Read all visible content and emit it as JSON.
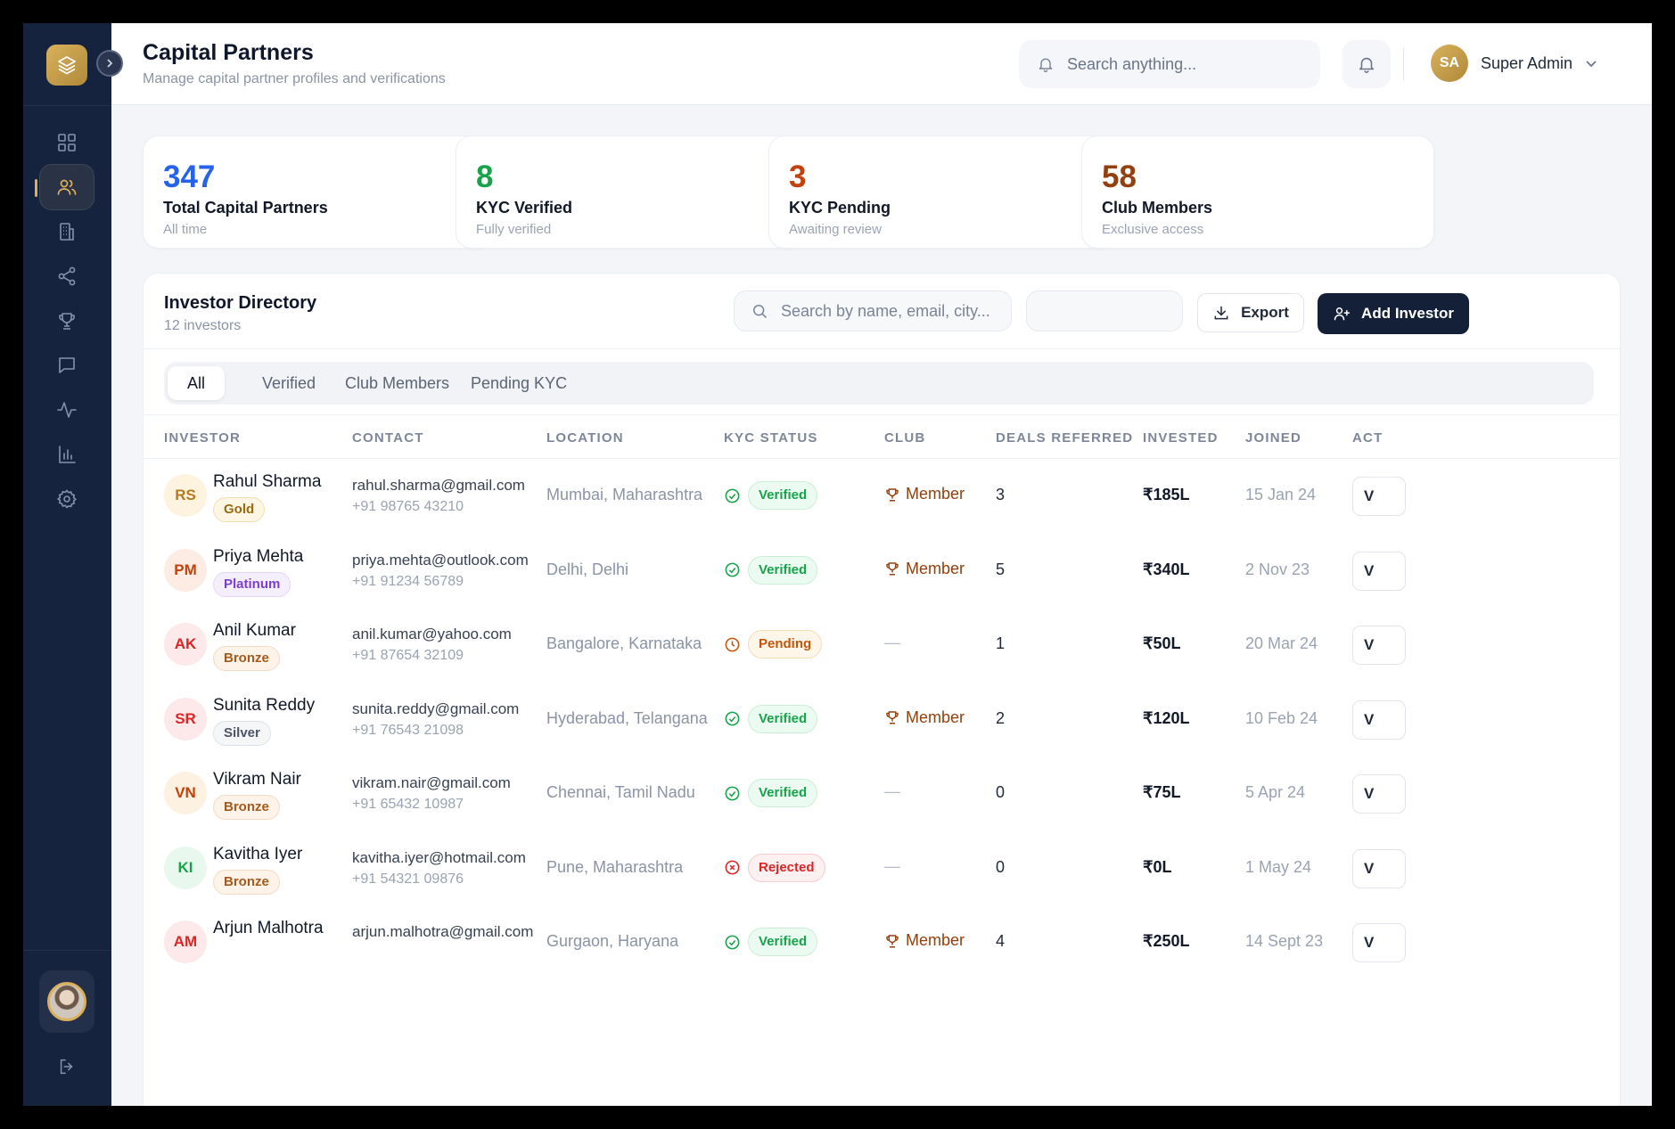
{
  "header": {
    "title": "Capital Partners",
    "subtitle": "Manage capital partner profiles and verifications",
    "search_placeholder": "Search anything...",
    "user_initials": "SA",
    "user_name": "Super Admin"
  },
  "sidebar": {
    "items": [
      {
        "icon": "grid-icon",
        "active": false
      },
      {
        "icon": "users-icon",
        "active": true
      },
      {
        "icon": "building-icon",
        "active": false
      },
      {
        "icon": "share-icon",
        "active": false
      },
      {
        "icon": "trophy-icon",
        "active": false
      },
      {
        "icon": "chat-icon",
        "active": false
      },
      {
        "icon": "activity-icon",
        "active": false
      },
      {
        "icon": "bar-chart-icon",
        "active": false
      },
      {
        "icon": "gear-icon",
        "active": false
      }
    ]
  },
  "stats": [
    {
      "value": "347",
      "label": "Total Capital Partners",
      "sub": "All time",
      "color": "#2563eb"
    },
    {
      "value": "8",
      "label": "KYC Verified",
      "sub": "Fully verified",
      "color": "#16a34a"
    },
    {
      "value": "3",
      "label": "KYC Pending",
      "sub": "Awaiting review",
      "color": "#c2410c"
    },
    {
      "value": "58",
      "label": "Club Members",
      "sub": "Exclusive access",
      "color": "#92400e"
    }
  ],
  "directory": {
    "title": "Investor Directory",
    "count": "12 investors",
    "search_placeholder": "Search by name, email, city...",
    "export_label": "Export",
    "add_label": "Add Investor",
    "tabs": [
      "All",
      "Verified",
      "Club Members",
      "Pending KYC"
    ],
    "active_tab": "All",
    "columns": [
      "INVESTOR",
      "CONTACT",
      "LOCATION",
      "KYC STATUS",
      "CLUB",
      "DEALS REFERRED",
      "INVESTED",
      "JOINED",
      "ACT"
    ],
    "rows": [
      {
        "initials": "RS",
        "name": "Rahul Sharma",
        "tier": "Gold",
        "email": "rahul.sharma@gmail.com",
        "phone": "+91 98765 43210",
        "location": "Mumbai, Maharashtra",
        "kyc": "Verified",
        "club": "Member",
        "deals": "3",
        "invested": "₹185L",
        "joined": "15 Jan 24",
        "action": "V"
      },
      {
        "initials": "PM",
        "name": "Priya Mehta",
        "tier": "Platinum",
        "email": "priya.mehta@outlook.com",
        "phone": "+91 91234 56789",
        "location": "Delhi, Delhi",
        "kyc": "Verified",
        "club": "Member",
        "deals": "5",
        "invested": "₹340L",
        "joined": "2 Nov 23",
        "action": "V"
      },
      {
        "initials": "AK",
        "name": "Anil Kumar",
        "tier": "Bronze",
        "email": "anil.kumar@yahoo.com",
        "phone": "+91 87654 32109",
        "location": "Bangalore, Karnataka",
        "kyc": "Pending",
        "club": "—",
        "deals": "1",
        "invested": "₹50L",
        "joined": "20 Mar 24",
        "action": "V"
      },
      {
        "initials": "SR",
        "name": "Sunita Reddy",
        "tier": "Silver",
        "email": "sunita.reddy@gmail.com",
        "phone": "+91 76543 21098",
        "location": "Hyderabad, Telangana",
        "kyc": "Verified",
        "club": "Member",
        "deals": "2",
        "invested": "₹120L",
        "joined": "10 Feb 24",
        "action": "V"
      },
      {
        "initials": "VN",
        "name": "Vikram Nair",
        "tier": "Bronze",
        "email": "vikram.nair@gmail.com",
        "phone": "+91 65432 10987",
        "location": "Chennai, Tamil Nadu",
        "kyc": "Verified",
        "club": "—",
        "deals": "0",
        "invested": "₹75L",
        "joined": "5 Apr 24",
        "action": "V"
      },
      {
        "initials": "KI",
        "name": "Kavitha Iyer",
        "tier": "Bronze",
        "email": "kavitha.iyer@hotmail.com",
        "phone": "+91 54321 09876",
        "location": "Pune, Maharashtra",
        "kyc": "Rejected",
        "club": "—",
        "deals": "0",
        "invested": "₹0L",
        "joined": "1 May 24",
        "action": "V"
      },
      {
        "initials": "AM",
        "name": "Arjun Malhotra",
        "tier": "",
        "email": "arjun.malhotra@gmail.com",
        "phone": "",
        "location": "Gurgaon, Haryana",
        "kyc": "Verified",
        "club": "Member",
        "deals": "4",
        "invested": "₹250L",
        "joined": "14 Sept 23",
        "action": "V"
      }
    ]
  },
  "colors": {
    "sidebar_bg": "#16233f",
    "accent_gold": "#d9b15c",
    "primary_button": "#142038"
  }
}
